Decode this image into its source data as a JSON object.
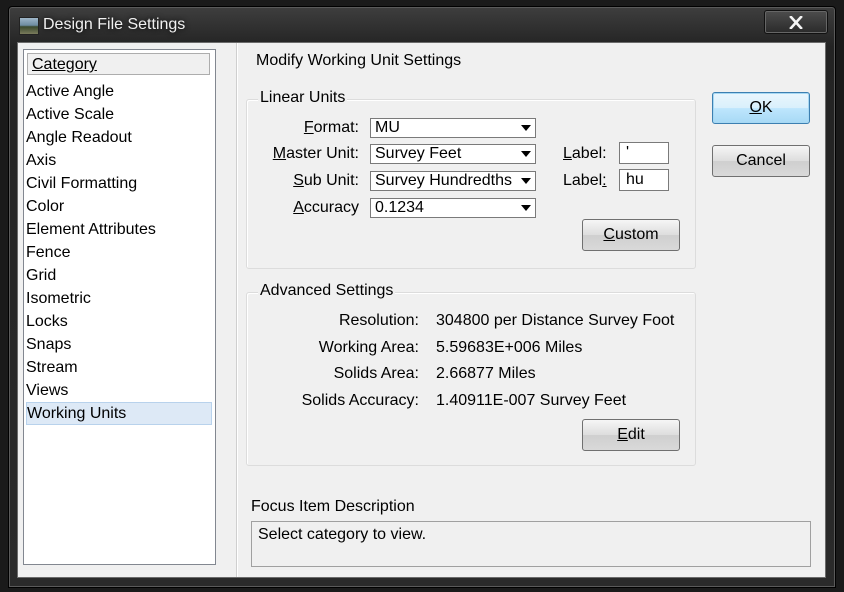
{
  "window": {
    "title": "Design File Settings"
  },
  "category": {
    "header": "Category",
    "items": [
      "Active Angle",
      "Active Scale",
      "Angle Readout",
      "Axis",
      "Civil Formatting",
      "Color",
      "Element Attributes",
      "Fence",
      "Grid",
      "Isometric",
      "Locks",
      "Snaps",
      "Stream",
      "Views",
      "Working Units"
    ],
    "selected": "Working Units"
  },
  "main": {
    "title": "Modify Working Unit Settings",
    "linear_units": {
      "label": "Linear Units",
      "format_label": "Format:",
      "format_value": "MU",
      "master_unit_label": "Master Unit:",
      "master_unit_value": "Survey Feet",
      "master_label_label": "Label:",
      "master_label_value": "'",
      "sub_unit_label": "Sub Unit:",
      "sub_unit_value": "Survey Hundredths",
      "sub_label_label": "Label:",
      "sub_label_value": "hu",
      "accuracy_label": "Accuracy",
      "accuracy_value": "0.1234",
      "custom_button": "Custom"
    },
    "advanced": {
      "label": "Advanced Settings",
      "resolution_label": "Resolution:",
      "resolution_value": "304800 per Distance Survey Foot",
      "working_area_label": "Working Area:",
      "working_area_value": "5.59683E+006 Miles",
      "solids_area_label": "Solids Area:",
      "solids_area_value": "2.66877 Miles",
      "solids_accuracy_label": "Solids Accuracy:",
      "solids_accuracy_value": "1.40911E-007 Survey Feet",
      "edit_button": "Edit"
    },
    "focus": {
      "label": "Focus Item Description",
      "text": "Select category to view."
    }
  },
  "buttons": {
    "ok": "OK",
    "cancel": "Cancel"
  }
}
